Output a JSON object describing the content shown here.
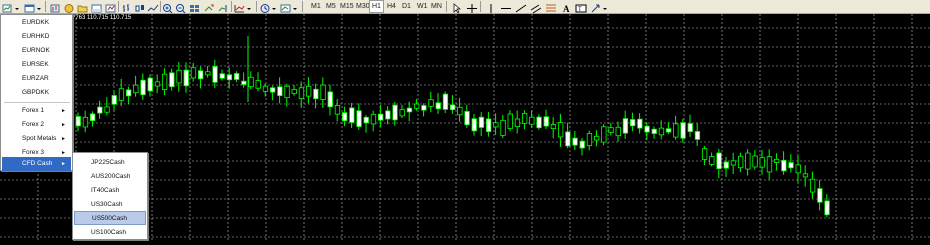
{
  "toolbar": {
    "timeframes": [
      "M1",
      "M5",
      "M15",
      "M30",
      "H1",
      "H4",
      "D1",
      "W1",
      "MN"
    ],
    "icons": [
      "new-chart-icon",
      "profiles-icon",
      "market-watch-icon",
      "navigator-icon",
      "folder-icon",
      "terminal-icon",
      "strategy-tester-icon",
      "bar-chart-icon",
      "candlestick-chart-icon",
      "line-chart-icon",
      "zoom-in-icon",
      "zoom-out-icon",
      "tile-windows-icon",
      "auto-scroll-icon",
      "chart-shift-icon",
      "indicators-icon",
      "templates-icon",
      "cursor-icon",
      "crosshair-icon",
      "vertical-line-icon",
      "horizontal-line-icon",
      "trendline-icon",
      "equidistant-channel-icon",
      "fibonacci-icon",
      "text-icon",
      "text-label-icon",
      "arrows-icon"
    ]
  },
  "chart": {
    "price_info": "?763 110.715 110.715",
    "colors": {
      "background": "#000000",
      "grid": "#c0c0c0",
      "bull_body": "#ffffff",
      "wick": "#00ff00"
    }
  },
  "menu1": {
    "items": [
      {
        "label": "EURDKK",
        "submenu": false
      },
      {
        "label": "EURHKD",
        "submenu": false
      },
      {
        "label": "EURNOK",
        "submenu": false
      },
      {
        "label": "EURSEK",
        "submenu": false
      },
      {
        "label": "EURZAR",
        "submenu": false
      },
      {
        "label": "GBPDKK",
        "submenu": false
      },
      {
        "label": "Forex 1",
        "submenu": true
      },
      {
        "label": "Forex 2",
        "submenu": true
      },
      {
        "label": "Spot Metals",
        "submenu": true
      },
      {
        "label": "Forex 3",
        "submenu": true
      },
      {
        "label": "CFD Cash",
        "submenu": true,
        "selected": true
      }
    ],
    "arrow_glyph": "►"
  },
  "menu2": {
    "items": [
      {
        "label": "JP225Cash"
      },
      {
        "label": "AUS200Cash"
      },
      {
        "label": "IT40Cash"
      },
      {
        "label": "US30Cash"
      },
      {
        "label": "US500Cash",
        "highlighted": true
      },
      {
        "label": "US100Cash"
      }
    ]
  }
}
